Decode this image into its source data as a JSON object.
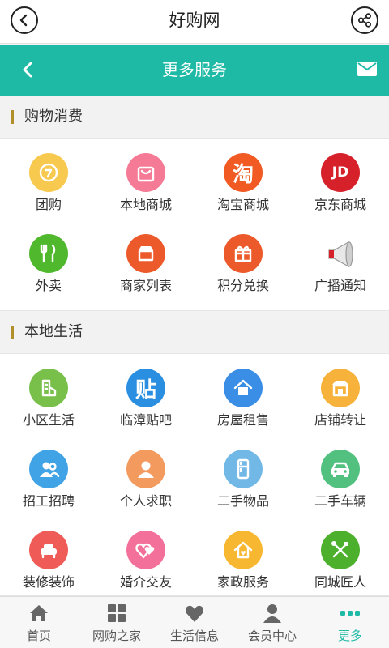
{
  "app": {
    "title": "好购网"
  },
  "navbar": {
    "title": "更多服务"
  },
  "colors": {
    "accent": "#1fbaa6",
    "section_marker": "#b18f2a"
  },
  "sections": [
    {
      "title": "购物消费",
      "items": [
        {
          "label": "团购",
          "icon": "groupbuy-icon",
          "color": "#f7c94e"
        },
        {
          "label": "本地商城",
          "icon": "shopping-bag-icon",
          "color": "#f47a95"
        },
        {
          "label": "淘宝商城",
          "icon": "taobao-icon",
          "color": "#f15a22",
          "glyph": "淘"
        },
        {
          "label": "京东商城",
          "icon": "jd-icon",
          "color": "#d6202a",
          "glyph": "JD"
        },
        {
          "label": "外卖",
          "icon": "fork-knife-icon",
          "color": "#4fb82c"
        },
        {
          "label": "商家列表",
          "icon": "store-icon",
          "color": "#ec5a2c"
        },
        {
          "label": "积分兑换",
          "icon": "gift-icon",
          "color": "#ec5a2c"
        },
        {
          "label": "广播通知",
          "icon": "megaphone-icon",
          "color": "#d8d8d8"
        }
      ]
    },
    {
      "title": "本地生活",
      "items": [
        {
          "label": "小区生活",
          "icon": "community-icon",
          "color": "#78c04a"
        },
        {
          "label": "临漳贴吧",
          "icon": "tieba-icon",
          "color": "#2b8fe1",
          "glyph": "贴"
        },
        {
          "label": "房屋租售",
          "icon": "house-icon",
          "color": "#3b8ee6"
        },
        {
          "label": "店铺转让",
          "icon": "shop-transfer-icon",
          "color": "#f6b23a"
        },
        {
          "label": "招工招聘",
          "icon": "recruit-icon",
          "color": "#3fa3e6"
        },
        {
          "label": "个人求职",
          "icon": "person-icon",
          "color": "#f39a5f"
        },
        {
          "label": "二手物品",
          "icon": "fridge-icon",
          "color": "#72b8e6"
        },
        {
          "label": "二手车辆",
          "icon": "car-icon",
          "color": "#52c07e"
        },
        {
          "label": "装修装饰",
          "icon": "sofa-icon",
          "color": "#ef5b57"
        },
        {
          "label": "婚介交友",
          "icon": "hearts-icon",
          "color": "#f3709b"
        },
        {
          "label": "家政服务",
          "icon": "home-service-icon",
          "color": "#f7b730"
        },
        {
          "label": "同城匠人",
          "icon": "tools-icon",
          "color": "#4db02d"
        }
      ]
    }
  ],
  "tabs": [
    {
      "label": "首页",
      "icon": "home-icon"
    },
    {
      "label": "网购之家",
      "icon": "grid-icon"
    },
    {
      "label": "生活信息",
      "icon": "heart-icon"
    },
    {
      "label": "会员中心",
      "icon": "user-icon"
    },
    {
      "label": "更多",
      "icon": "more-dots-icon",
      "active": true
    }
  ]
}
